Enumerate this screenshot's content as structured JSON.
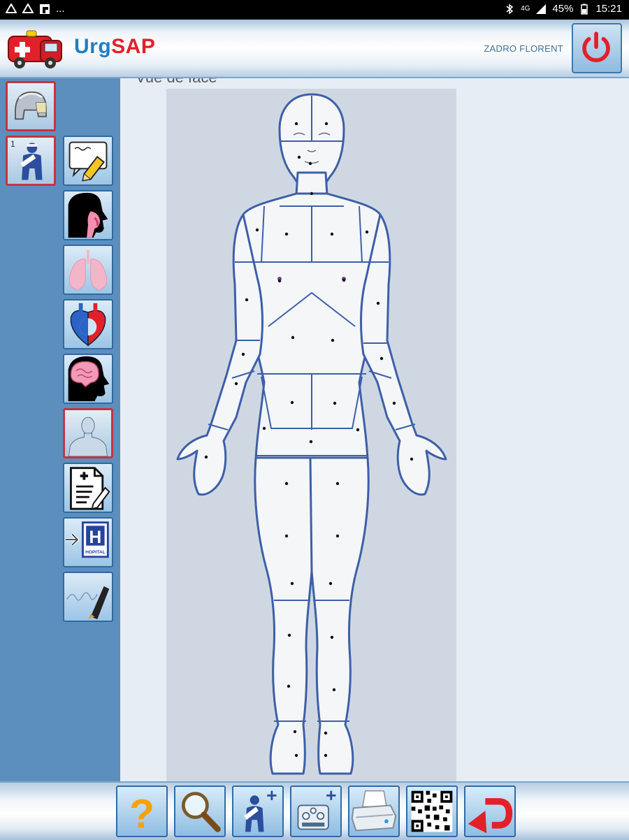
{
  "status_bar": {
    "ellipsis": "...",
    "network": "4G",
    "battery": "45%",
    "time": "15:21"
  },
  "header": {
    "brand_urg": "Urg",
    "brand_sap": "SAP",
    "username": "ZADRO FLORENT"
  },
  "sidebar": {
    "victim_count": "1",
    "items": [
      {
        "icon": "firefighter-helmet-icon",
        "selected": true
      },
      {
        "icon": "victim-icon",
        "selected": true
      },
      {
        "icon": "notes-icon"
      },
      {
        "icon": "airway-icon"
      },
      {
        "icon": "lungs-icon"
      },
      {
        "icon": "heart-icon"
      },
      {
        "icon": "brain-icon"
      },
      {
        "icon": "body-icon",
        "selected": true
      },
      {
        "icon": "medical-form-icon"
      },
      {
        "icon": "hospital-transfer-icon"
      },
      {
        "icon": "signature-icon"
      }
    ],
    "hospital_label": "HOPITAL",
    "hospital_letter": "H"
  },
  "main": {
    "view_title": "Vue de face"
  },
  "toolbar": {
    "help_label": "?",
    "buttons": [
      "help-icon",
      "magnifier-icon",
      "add-victim-icon",
      "add-equipment-icon",
      "printer-icon",
      "qr-code-icon",
      "back-arrow-icon"
    ]
  },
  "colors": {
    "brand_blue": "#1f7ec6",
    "brand_red": "#e2202a",
    "sidebar_bg": "#5c8fbe",
    "selected_border": "#c4353f",
    "outline": "#3e5fa8"
  }
}
